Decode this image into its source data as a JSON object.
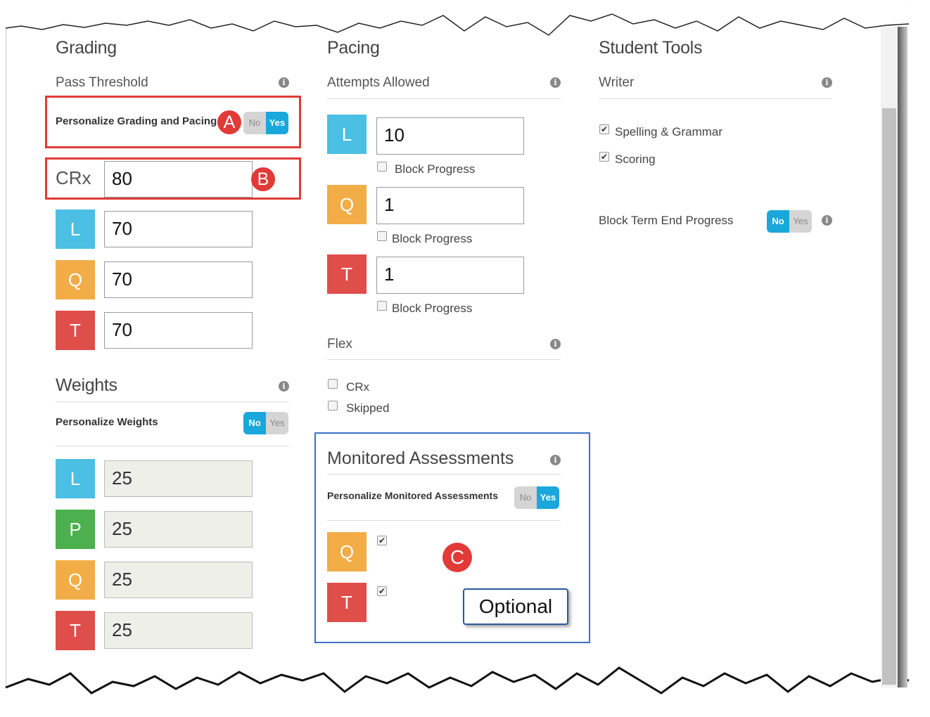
{
  "grading": {
    "title": "Grading",
    "pass_threshold": {
      "label": "Pass Threshold",
      "personalize_label": "Personalize Grading and Pacing",
      "toggle": {
        "no": "No",
        "yes": "Yes",
        "selected": "Yes"
      },
      "crx": {
        "label": "CRx",
        "value": "80"
      },
      "rows": [
        {
          "badge": "L",
          "value": "70"
        },
        {
          "badge": "Q",
          "value": "70"
        },
        {
          "badge": "T",
          "value": "70"
        }
      ]
    },
    "weights": {
      "title": "Weights",
      "personalize_label": "Personalize Weights",
      "toggle": {
        "no": "No",
        "yes": "Yes",
        "selected": "No"
      },
      "rows": [
        {
          "badge": "L",
          "value": "25"
        },
        {
          "badge": "P",
          "value": "25"
        },
        {
          "badge": "Q",
          "value": "25"
        },
        {
          "badge": "T",
          "value": "25"
        }
      ]
    }
  },
  "pacing": {
    "title": "Pacing",
    "attempts": {
      "label": "Attempts Allowed",
      "rows": [
        {
          "badge": "L",
          "value": "10",
          "block_label": "Block Progress",
          "checked": false
        },
        {
          "badge": "Q",
          "value": "1",
          "block_label": "Block Progress",
          "checked": false
        },
        {
          "badge": "T",
          "value": "1",
          "block_label": "Block Progress",
          "checked": false
        }
      ]
    },
    "flex": {
      "label": "Flex",
      "options": [
        {
          "label": "CRx",
          "checked": false
        },
        {
          "label": "Skipped",
          "checked": false
        }
      ]
    },
    "monitored": {
      "title": "Monitored Assessments",
      "personalize_label": "Personalize Monitored Assessments",
      "toggle": {
        "no": "No",
        "yes": "Yes",
        "selected": "Yes"
      },
      "rows": [
        {
          "badge": "Q",
          "checked": true
        },
        {
          "badge": "T",
          "checked": true
        }
      ]
    }
  },
  "student_tools": {
    "title": "Student Tools",
    "writer": {
      "label": "Writer",
      "options": [
        {
          "label": "Spelling & Grammar",
          "checked": true
        },
        {
          "label": "Scoring",
          "checked": true
        }
      ]
    },
    "block_term": {
      "label": "Block Term End Progress",
      "toggle": {
        "no": "No",
        "yes": "Yes",
        "selected": "No"
      }
    }
  },
  "annotations": {
    "a": "A",
    "b": "B",
    "c": "C",
    "callout": "Optional"
  },
  "icons": {
    "info": "info-icon",
    "check": "✔"
  },
  "colors": {
    "l": "#4bbfe4",
    "q": "#f2ad47",
    "t": "#e04e4a",
    "p": "#4bb04d",
    "toggle_on": "#1aa7dc",
    "annotation_red": "#e23a36",
    "annotation_blue": "#3a6fc7"
  }
}
